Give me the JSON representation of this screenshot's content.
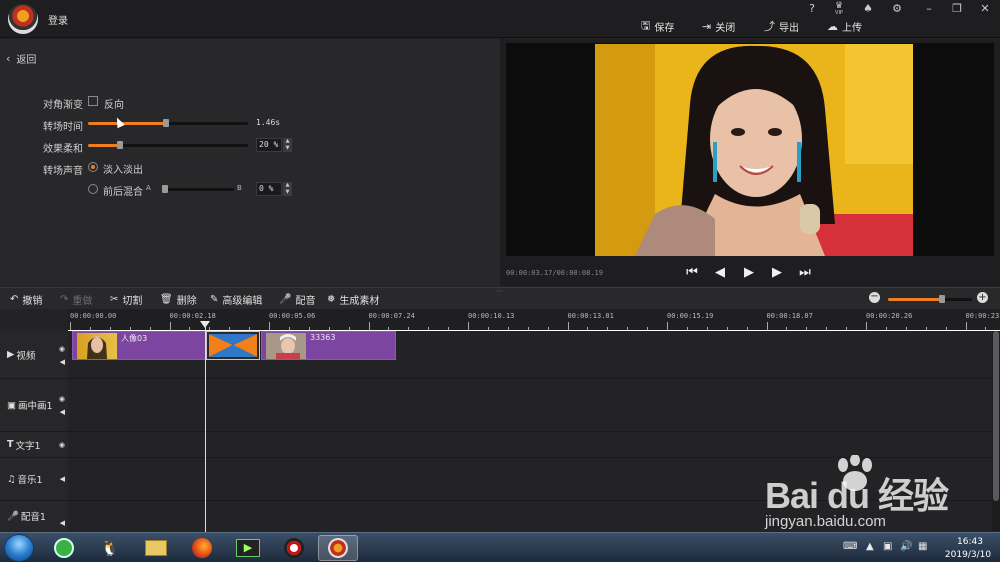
{
  "topbar": {
    "login": "登录",
    "icons": [
      "help-icon",
      "vip-icon",
      "bell-icon",
      "gear-icon",
      "minimize-icon",
      "maximize-icon",
      "close-icon"
    ],
    "help_glyph": "?",
    "vip_text": "VIP",
    "actions": [
      {
        "label": "保存",
        "icon": "save-icon",
        "glyph": "🖫"
      },
      {
        "label": "关闭",
        "icon": "exit-icon",
        "glyph": "⇥"
      },
      {
        "label": "导出",
        "icon": "export-icon",
        "glyph": "⤴"
      },
      {
        "label": "上传",
        "icon": "upload-cloud-icon",
        "glyph": "☁"
      }
    ]
  },
  "left": {
    "back": "返回",
    "diagonal_label": "对角渐变",
    "reverse_label": "反向",
    "reverse_checked": false,
    "duration_label": "转场时间",
    "duration_value": "1.46s",
    "duration_fraction": 0.49,
    "softness_label": "效果柔和",
    "softness_value": "20 %",
    "softness_fraction": 0.2,
    "sound_label": "转场声音",
    "fade_label": "淡入淡出",
    "mix_label": "前后混合",
    "mix_a": "A",
    "mix_b": "B",
    "mix_value": "0 %",
    "mix_fraction": 0.0,
    "selected_sound": "fade"
  },
  "preview": {
    "timecode": "00:00:03.17/00:00:08.19",
    "controls": [
      "skip-start-icon",
      "step-back-icon",
      "play-icon",
      "step-forward-icon",
      "skip-end-icon"
    ]
  },
  "toolbar": {
    "undo": "撤销",
    "redo": "重做",
    "cut": "切割",
    "delete": "删除",
    "advanced": "高级编辑",
    "dub": "配音",
    "generate": "生成素材",
    "zoom_fraction": 0.64
  },
  "ruler": {
    "labels": [
      "00:00:00.00",
      "00:00:02.18",
      "00:00:05.06",
      "00:00:07.24",
      "00:00:10.13",
      "00:00:13.01",
      "00:00:15.19",
      "00:00:18.07",
      "00:00:20.26",
      "00:00:23."
    ]
  },
  "tracks": {
    "video": "视频",
    "pip": "画中画1",
    "text": "文字1",
    "music": "音乐1",
    "voice": "配音1"
  },
  "clips": [
    {
      "name": "人像03"
    },
    {
      "name": "33363"
    }
  ],
  "taskbar": {
    "time": "16:43",
    "date": "2019/3/10"
  },
  "watermark": {
    "text": "Bai du 经验",
    "url": "jingyan.baidu.com"
  },
  "colors": {
    "accent": "#ef7d22",
    "clip": "#7c45a0",
    "transition_orange": "#f07f1c"
  }
}
